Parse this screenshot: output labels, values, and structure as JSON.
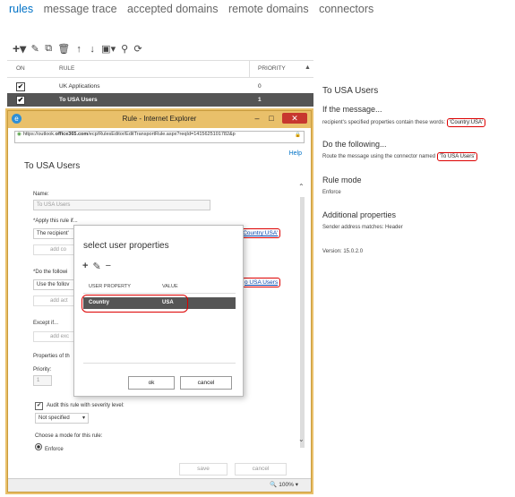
{
  "nav": {
    "items": [
      "rules",
      "message trace",
      "accepted domains",
      "remote domains",
      "connectors"
    ],
    "active_index": 0,
    "accent_color": "#0072c6"
  },
  "toolbar": {
    "icons": [
      "add-icon",
      "edit-icon",
      "copy-icon",
      "delete-icon",
      "move-up-icon",
      "move-down-icon",
      "report-icon",
      "search-icon",
      "refresh-icon"
    ]
  },
  "table": {
    "headers": {
      "on": "ON",
      "rule": "RULE",
      "priority": "PRIORITY"
    },
    "rows": [
      {
        "rule": "UK Applications",
        "priority": "0",
        "on": true,
        "selected": false
      },
      {
        "rule": "To USA Users",
        "priority": "1",
        "on": true,
        "selected": true
      }
    ]
  },
  "details": {
    "title": "To USA Users",
    "if_heading": "If the message...",
    "if_text": "recipient's specified properties contain these words:",
    "if_value": "'Country:USA'",
    "do_heading": "Do the following...",
    "do_text": "Route the message using the connector named",
    "do_value": "'To USA Users'",
    "mode_heading": "Rule mode",
    "mode_value": "Enforce",
    "addl_heading": "Additional properties",
    "addl_value": "Sender address matches: Header",
    "version": "Version: 15.0.2.0"
  },
  "ie": {
    "title": "Rule - Internet Explorer",
    "url_scheme": "https://outlook.",
    "url_domain": "office365.com",
    "url_rest": "/ecp/RulesEditor/EditTransportRule.aspx?reqId=1415625101782&p",
    "help": "Help",
    "rule_title": "To USA Users",
    "name_label": "Name:",
    "name_value": "To USA Users",
    "apply_label": "*Apply this rule if...",
    "apply_value": "The recipient'",
    "add_condition": "add co",
    "apply_link": "'Country:USA'",
    "do_label": "*Do the followi",
    "do_value": "Use the follov",
    "add_action": "add act",
    "do_link": "o USA Users",
    "except_label": "Except if...",
    "add_exception": "add exc",
    "properties_label": "Properties of th",
    "priority_label": "Priority:",
    "priority_value": "1",
    "audit_label": "Audit this rule with severity level:",
    "severity_value": "Not specified",
    "mode_label": "Choose a mode for this rule:",
    "mode_value": "Enforce",
    "save": "save",
    "cancel": "cancel",
    "zoom": "100%"
  },
  "dialog": {
    "title": "select user properties",
    "headers": {
      "property": "USER PROPERTY",
      "value": "VALUE"
    },
    "rows": [
      {
        "property": "Country",
        "value": "USA"
      }
    ],
    "ok": "ok",
    "cancel": "cancel"
  }
}
